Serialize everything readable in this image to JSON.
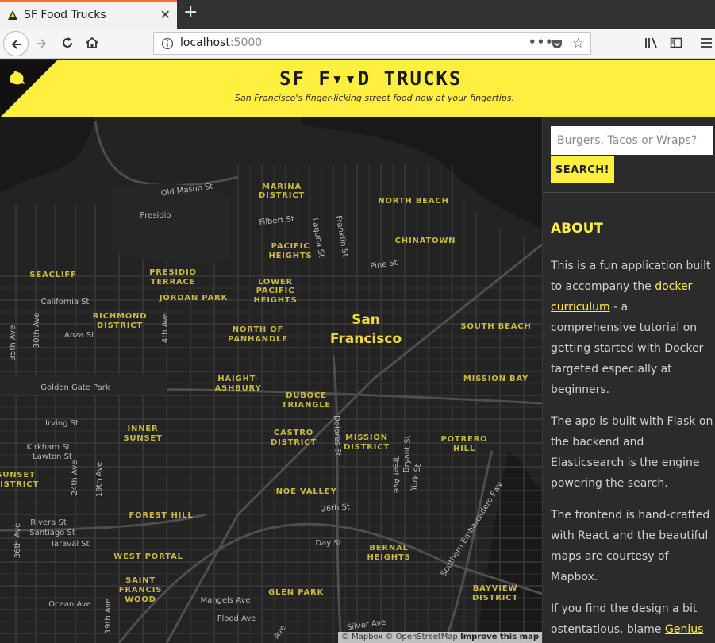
{
  "browser": {
    "tab_title": "SF Food Trucks",
    "url_host": "localhost",
    "url_port": ":5000",
    "icons": [
      "favicon-icon",
      "close-icon",
      "new-tab-icon",
      "back-icon",
      "forward-icon",
      "reload-icon",
      "home-icon",
      "info-icon",
      "more-icon",
      "pocket-icon",
      "star-icon",
      "library-icon",
      "sidebar-icon",
      "menu-icon"
    ]
  },
  "header": {
    "title": "SF F▾▾D TRUCKS",
    "tagline": "San Francisco's finger-licking street food now at your fingertips.",
    "background": "#ffef3f"
  },
  "map": {
    "city_label_1": "San",
    "city_label_2": "Francisco",
    "neighborhoods": [
      "MARINA",
      "DISTRICT",
      "NORTH BEACH",
      "PACIFIC",
      "HEIGHTS",
      "CHINATOWN",
      "SEACLIFF",
      "PRESIDIO",
      "TERRACE",
      "JORDAN PARK",
      "LOWER",
      "PACIFIC",
      "HEIGHTS",
      "RICHMOND",
      "DISTRICT",
      "NORTH OF",
      "PANHANDLE",
      "SOUTH BEACH",
      "HAIGHT-",
      "ASHBURY",
      "MISSION BAY",
      "DUBOCE",
      "TRIANGLE",
      "INNER",
      "SUNSET",
      "CASTRO",
      "DISTRICT",
      "MISSION",
      "DISTRICT",
      "POTRERO",
      "HILL",
      "SUNSET",
      "DISTRICT",
      "NOE VALLEY",
      "FOREST HILL",
      "BERNAL",
      "HEIGHTS",
      "WEST PORTAL",
      "SAINT",
      "FRANCIS",
      "WOOD",
      "GLEN PARK",
      "BAYVIEW",
      "DISTRICT"
    ],
    "streets": [
      "Old Mason St",
      "Presidio",
      "Filbert St",
      "Laguna St",
      "Franklin St",
      "Pine St",
      "California St",
      "Anza St",
      "35th Ave",
      "30th Ave",
      "4th Ave",
      "Golden Gate Park",
      "Irving St",
      "Kirkham St",
      "Lawton St",
      "24th Ave",
      "19th Ave",
      "Dolores St",
      "Bryant St",
      "York St",
      "Treat Ave",
      "26th St",
      "Rivera St",
      "Santiago St",
      "Taraval St",
      "36th Ave",
      "Day St",
      "Southern Embarcadero Fwy",
      "Mangels Ave",
      "Ocean Ave",
      "Flood Ave",
      "Silver Ave",
      "19th Ave",
      "Ave"
    ],
    "attribution_1": "© Mapbox © OpenStreetMap",
    "attribution_2": "Improve this map"
  },
  "sidebar": {
    "search_placeholder": "Burgers, Tacos or Wraps?",
    "search_button": "SEARCH!",
    "about_heading": "ABOUT",
    "p1_a": "This is a fun application built to accompany the ",
    "p1_link": "docker curriculum",
    "p1_b": " - a comprehensive tutorial on getting started with Docker targeted especially at beginners.",
    "p2": "The app is built with Flask on the backend and Elasticsearch is the engine powering the search.",
    "p3": "The frontend is hand-crafted with React and the beautiful maps are courtesy of Mapbox.",
    "p4_a": "If you find the design a bit ostentatious, blame ",
    "p4_link": "Genius"
  },
  "colors": {
    "accent": "#ffef3f",
    "map_bg": "#1c1c1c",
    "map_label": "#c9b940"
  }
}
